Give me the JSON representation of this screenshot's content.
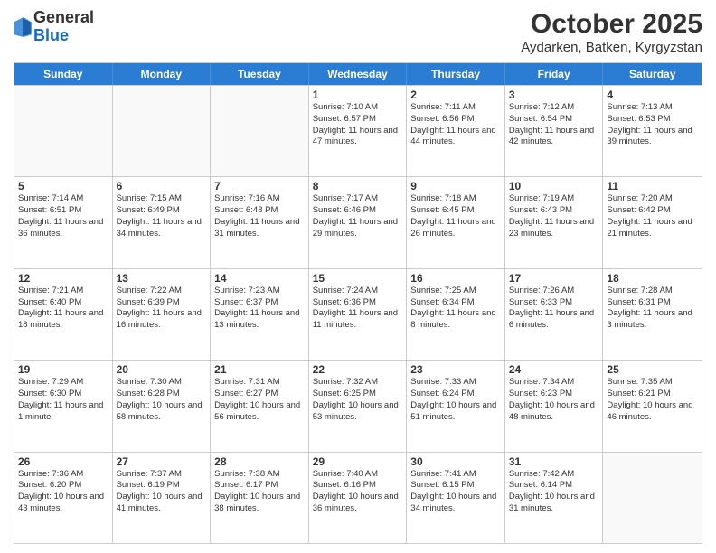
{
  "logo": {
    "general": "General",
    "blue": "Blue"
  },
  "header": {
    "title": "October 2025",
    "subtitle": "Aydarken, Batken, Kyrgyzstan"
  },
  "weekdays": [
    "Sunday",
    "Monday",
    "Tuesday",
    "Wednesday",
    "Thursday",
    "Friday",
    "Saturday"
  ],
  "weeks": [
    [
      {
        "day": "",
        "info": ""
      },
      {
        "day": "",
        "info": ""
      },
      {
        "day": "",
        "info": ""
      },
      {
        "day": "1",
        "info": "Sunrise: 7:10 AM\nSunset: 6:57 PM\nDaylight: 11 hours and 47 minutes."
      },
      {
        "day": "2",
        "info": "Sunrise: 7:11 AM\nSunset: 6:56 PM\nDaylight: 11 hours and 44 minutes."
      },
      {
        "day": "3",
        "info": "Sunrise: 7:12 AM\nSunset: 6:54 PM\nDaylight: 11 hours and 42 minutes."
      },
      {
        "day": "4",
        "info": "Sunrise: 7:13 AM\nSunset: 6:53 PM\nDaylight: 11 hours and 39 minutes."
      }
    ],
    [
      {
        "day": "5",
        "info": "Sunrise: 7:14 AM\nSunset: 6:51 PM\nDaylight: 11 hours and 36 minutes."
      },
      {
        "day": "6",
        "info": "Sunrise: 7:15 AM\nSunset: 6:49 PM\nDaylight: 11 hours and 34 minutes."
      },
      {
        "day": "7",
        "info": "Sunrise: 7:16 AM\nSunset: 6:48 PM\nDaylight: 11 hours and 31 minutes."
      },
      {
        "day": "8",
        "info": "Sunrise: 7:17 AM\nSunset: 6:46 PM\nDaylight: 11 hours and 29 minutes."
      },
      {
        "day": "9",
        "info": "Sunrise: 7:18 AM\nSunset: 6:45 PM\nDaylight: 11 hours and 26 minutes."
      },
      {
        "day": "10",
        "info": "Sunrise: 7:19 AM\nSunset: 6:43 PM\nDaylight: 11 hours and 23 minutes."
      },
      {
        "day": "11",
        "info": "Sunrise: 7:20 AM\nSunset: 6:42 PM\nDaylight: 11 hours and 21 minutes."
      }
    ],
    [
      {
        "day": "12",
        "info": "Sunrise: 7:21 AM\nSunset: 6:40 PM\nDaylight: 11 hours and 18 minutes."
      },
      {
        "day": "13",
        "info": "Sunrise: 7:22 AM\nSunset: 6:39 PM\nDaylight: 11 hours and 16 minutes."
      },
      {
        "day": "14",
        "info": "Sunrise: 7:23 AM\nSunset: 6:37 PM\nDaylight: 11 hours and 13 minutes."
      },
      {
        "day": "15",
        "info": "Sunrise: 7:24 AM\nSunset: 6:36 PM\nDaylight: 11 hours and 11 minutes."
      },
      {
        "day": "16",
        "info": "Sunrise: 7:25 AM\nSunset: 6:34 PM\nDaylight: 11 hours and 8 minutes."
      },
      {
        "day": "17",
        "info": "Sunrise: 7:26 AM\nSunset: 6:33 PM\nDaylight: 11 hours and 6 minutes."
      },
      {
        "day": "18",
        "info": "Sunrise: 7:28 AM\nSunset: 6:31 PM\nDaylight: 11 hours and 3 minutes."
      }
    ],
    [
      {
        "day": "19",
        "info": "Sunrise: 7:29 AM\nSunset: 6:30 PM\nDaylight: 11 hours and 1 minute."
      },
      {
        "day": "20",
        "info": "Sunrise: 7:30 AM\nSunset: 6:28 PM\nDaylight: 10 hours and 58 minutes."
      },
      {
        "day": "21",
        "info": "Sunrise: 7:31 AM\nSunset: 6:27 PM\nDaylight: 10 hours and 56 minutes."
      },
      {
        "day": "22",
        "info": "Sunrise: 7:32 AM\nSunset: 6:25 PM\nDaylight: 10 hours and 53 minutes."
      },
      {
        "day": "23",
        "info": "Sunrise: 7:33 AM\nSunset: 6:24 PM\nDaylight: 10 hours and 51 minutes."
      },
      {
        "day": "24",
        "info": "Sunrise: 7:34 AM\nSunset: 6:23 PM\nDaylight: 10 hours and 48 minutes."
      },
      {
        "day": "25",
        "info": "Sunrise: 7:35 AM\nSunset: 6:21 PM\nDaylight: 10 hours and 46 minutes."
      }
    ],
    [
      {
        "day": "26",
        "info": "Sunrise: 7:36 AM\nSunset: 6:20 PM\nDaylight: 10 hours and 43 minutes."
      },
      {
        "day": "27",
        "info": "Sunrise: 7:37 AM\nSunset: 6:19 PM\nDaylight: 10 hours and 41 minutes."
      },
      {
        "day": "28",
        "info": "Sunrise: 7:38 AM\nSunset: 6:17 PM\nDaylight: 10 hours and 38 minutes."
      },
      {
        "day": "29",
        "info": "Sunrise: 7:40 AM\nSunset: 6:16 PM\nDaylight: 10 hours and 36 minutes."
      },
      {
        "day": "30",
        "info": "Sunrise: 7:41 AM\nSunset: 6:15 PM\nDaylight: 10 hours and 34 minutes."
      },
      {
        "day": "31",
        "info": "Sunrise: 7:42 AM\nSunset: 6:14 PM\nDaylight: 10 hours and 31 minutes."
      },
      {
        "day": "",
        "info": ""
      }
    ]
  ]
}
